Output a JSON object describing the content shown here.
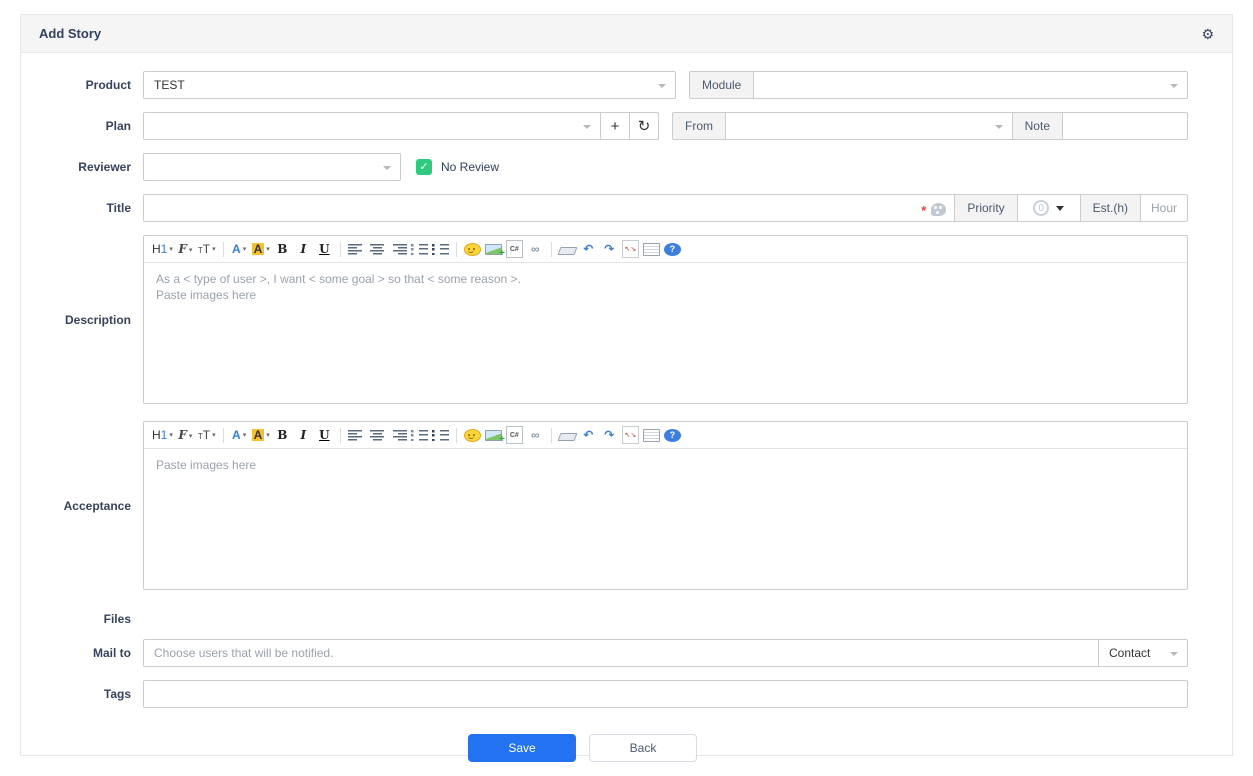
{
  "header": {
    "title": "Add Story"
  },
  "form": {
    "product": {
      "label": "Product",
      "value": "TEST"
    },
    "module": {
      "label": "Module",
      "value": ""
    },
    "plan": {
      "label": "Plan",
      "value": "",
      "add_button": "+",
      "refresh_glyph": "↻"
    },
    "from": {
      "label": "From",
      "value": ""
    },
    "note": {
      "label": "Note",
      "value": ""
    },
    "reviewer": {
      "label": "Reviewer",
      "value": "",
      "no_review_label": "No Review",
      "checked": true,
      "check_glyph": "✓"
    },
    "title": {
      "label": "Title",
      "value": "",
      "required_mark": "*"
    },
    "priority": {
      "label": "Priority",
      "value": "0"
    },
    "estimate": {
      "label": "Est.(h)",
      "placeholder": "Hour",
      "value": ""
    },
    "description": {
      "label": "Description",
      "placeholder_line1": "As a < type of user >, I want < some goal > so that < some reason >.",
      "placeholder_line2": "Paste images here"
    },
    "acceptance": {
      "label": "Acceptance",
      "placeholder": "Paste images here"
    },
    "files": {
      "label": "Files"
    },
    "mailto": {
      "label": "Mail to",
      "placeholder": "Choose users that will be notified.",
      "contact_label": "Contact"
    },
    "tags": {
      "label": "Tags",
      "value": ""
    }
  },
  "editor": {
    "toolbar": [
      {
        "name": "heading",
        "parts": [
          {
            "text": "H",
            "color": "#333333"
          },
          {
            "text": "1",
            "color": "#2e7ee5"
          }
        ],
        "caret": true
      },
      {
        "name": "font-family",
        "glyph": "F",
        "color": "#444444",
        "cls": "fw-b fs-i serif-f",
        "caret": true
      },
      {
        "name": "font-size",
        "parts": [
          {
            "text": "T",
            "color": "#444444",
            "small": true
          },
          {
            "text": "T",
            "color": "#444444"
          }
        ],
        "caret": true
      },
      {
        "sep": true
      },
      {
        "name": "text-color",
        "glyph": "A",
        "color": "#2e7ee5",
        "cls": "fw-b",
        "caret": true
      },
      {
        "name": "highlight-color",
        "glyph": "A",
        "color": "#333333",
        "bg": "#f7c02c",
        "cls": "fw-b",
        "caret": true
      },
      {
        "name": "bold",
        "glyph": "B",
        "color": "#222222",
        "cls": "fw-b serif-f"
      },
      {
        "name": "italic",
        "glyph": "I",
        "color": "#222222",
        "cls": "fw-b fs-i serif-f"
      },
      {
        "name": "underline",
        "glyph": "U",
        "color": "#222222",
        "cls": "fw-b td-u serif-f"
      },
      {
        "sep": true
      },
      {
        "name": "align-left",
        "cls": "icon-bars bars-left"
      },
      {
        "name": "align-center",
        "cls": "icon-bars bars-center"
      },
      {
        "name": "align-right",
        "cls": "icon-bars bars-right"
      },
      {
        "name": "ordered-list",
        "cls": "icon-bars bars-olist"
      },
      {
        "name": "unordered-list",
        "cls": "icon-bars bars-ulist"
      },
      {
        "sep": true
      },
      {
        "name": "emoticon",
        "cls": "icon-smiley"
      },
      {
        "name": "insert-image",
        "cls": "icon-image"
      },
      {
        "name": "paste-code",
        "glyph": "C#",
        "cls": "icon-codedoc"
      },
      {
        "name": "hyperlink",
        "glyph": "∞",
        "color": "#8a97a8",
        "cls": "fw-b"
      },
      {
        "sep": true
      },
      {
        "name": "remove-format",
        "cls": "icon-eraser"
      },
      {
        "name": "undo",
        "glyph": "↶",
        "color": "#3a7bd5",
        "cls": "fw-b"
      },
      {
        "name": "redo",
        "glyph": "↷",
        "color": "#3a7bd5",
        "cls": "fw-b"
      },
      {
        "name": "fullscreen",
        "parts": [
          {
            "text": "↖",
            "color": "#c0392b",
            "small": true
          },
          {
            "text": "↘",
            "color": "#c0392b",
            "small": true
          }
        ],
        "cls": "icon-fullscreen"
      },
      {
        "name": "source-code",
        "cls": "icon-notepad"
      },
      {
        "name": "help",
        "glyph": "?",
        "cls": "icon-help"
      }
    ]
  },
  "buttons": {
    "save": "Save",
    "back": "Back"
  },
  "icons": {
    "gear": "⚙"
  },
  "colors": {
    "accent_blue": "#2272f2",
    "checkbox_green": "#2fca7f",
    "required_red": "#e5433e",
    "highlight_yellow": "#f7c02c"
  }
}
